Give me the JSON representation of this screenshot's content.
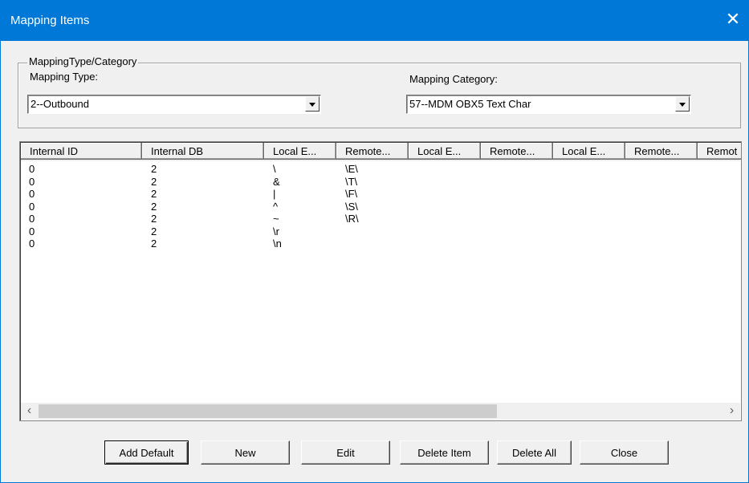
{
  "window": {
    "title": "Mapping Items",
    "close_glyph": "✕"
  },
  "group": {
    "legend": "MappingType/Category",
    "mapping_type_label": "Mapping Type:",
    "mapping_type_value": "2--Outbound",
    "mapping_category_label": "Mapping Category:",
    "mapping_category_value": "57--MDM OBX5 Text Char"
  },
  "table": {
    "columns": [
      "Internal ID",
      "Internal DB",
      "Local E...",
      "Remote...",
      "Local E...",
      "Remote...",
      "Local E...",
      "Remote...",
      "Remot"
    ],
    "rows": [
      [
        "0",
        "2",
        "\\",
        "\\E\\"
      ],
      [
        "0",
        "2",
        "&",
        "\\T\\"
      ],
      [
        "0",
        "2",
        "|",
        "\\F\\"
      ],
      [
        "0",
        "2",
        "^",
        "\\S\\"
      ],
      [
        "0",
        "2",
        "~",
        "\\R\\"
      ],
      [
        "0",
        "2",
        "\\r",
        ""
      ],
      [
        "0",
        "2",
        "\\n",
        ""
      ]
    ]
  },
  "scrollbar": {
    "left_glyph": "‹",
    "right_glyph": "›"
  },
  "buttons": {
    "add_default": "Add Default",
    "new": "New",
    "edit": "Edit",
    "delete_item": "Delete Item",
    "delete_all": "Delete All",
    "close": "Close"
  },
  "colors": {
    "title_bar": "#0078d7",
    "dialog_bg": "#f0f0f0"
  }
}
